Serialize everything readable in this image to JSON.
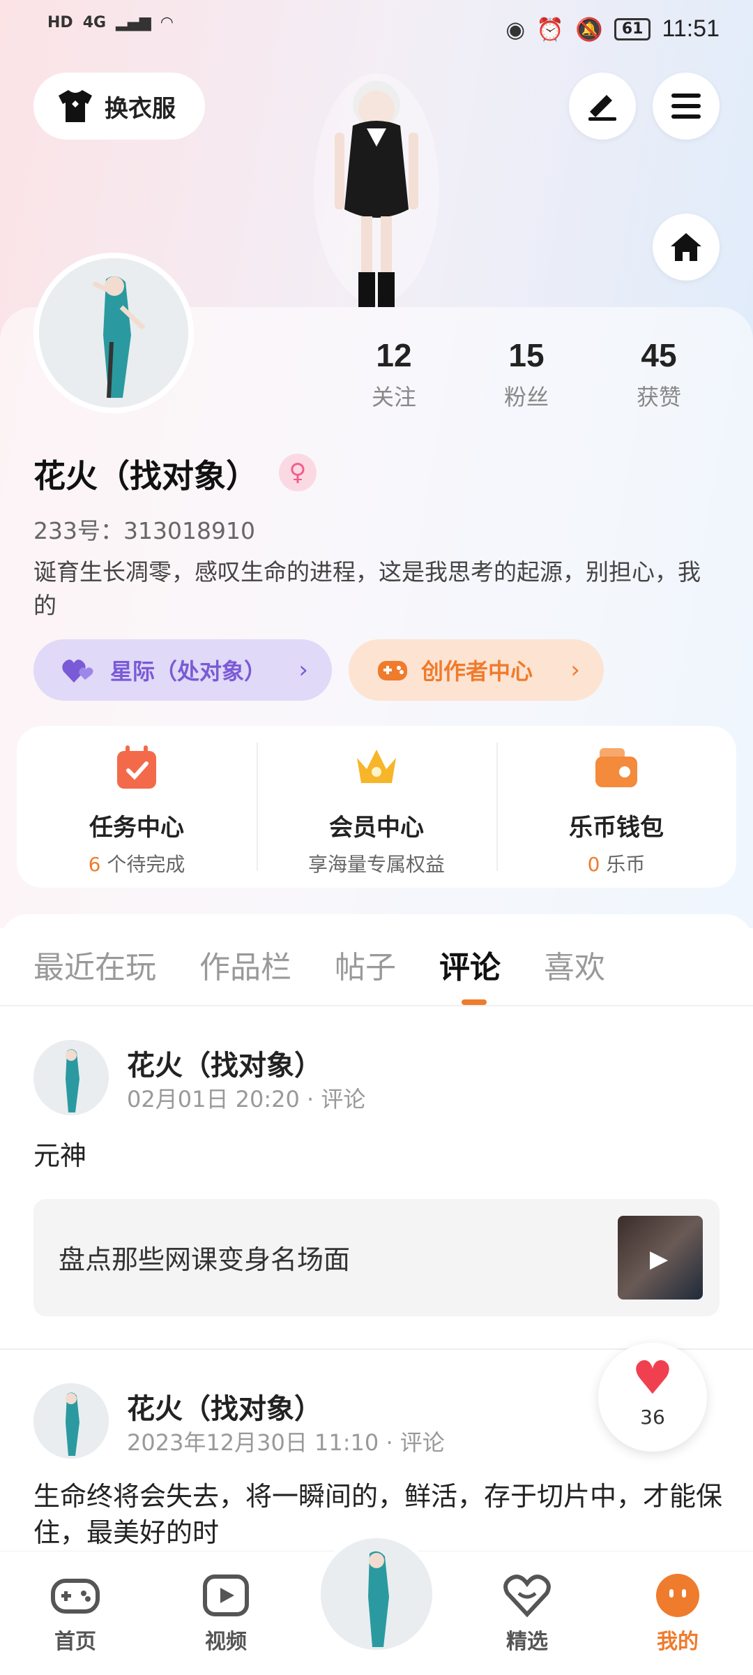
{
  "status_bar": {
    "left_indicators": [
      "HD",
      "4G"
    ],
    "battery": "61",
    "time": "11:51"
  },
  "header": {
    "outfit_label": "换衣服"
  },
  "profile": {
    "stats": [
      {
        "num": "12",
        "label": "关注"
      },
      {
        "num": "15",
        "label": "粉丝"
      },
      {
        "num": "45",
        "label": "获赞"
      }
    ],
    "name": "花火（找对象）",
    "gender_symbol": "♀",
    "uid": "233号：313018910",
    "bio": "诞育生长凋零，感叹生命的进程，这是我思考的起源，别担心，我的"
  },
  "pills": {
    "interstellar": "星际（处对象）",
    "creator": "创作者中心"
  },
  "quick": [
    {
      "title": "任务中心",
      "sub_num": "6",
      "sub_text": " 个待完成"
    },
    {
      "title": "会员中心",
      "sub_num": "",
      "sub_text": "享海量专属权益"
    },
    {
      "title": "乐币钱包",
      "sub_num": "0",
      "sub_text": " 乐币"
    }
  ],
  "tabs": [
    "最近在玩",
    "作品栏",
    "帖子",
    "评论",
    "喜欢"
  ],
  "posts": [
    {
      "name": "花火（找对象）",
      "meta": "02月01日 20:20 · 评论",
      "body": "元神",
      "ref_title": "盘点那些网课变身名场面"
    },
    {
      "name": "花火（找对象）",
      "meta": "2023年12月30日 11:10 · 评论",
      "body": "生命终将会失去，将一瞬间的，鲜活，存于切片中，才能保住，最美好的时"
    }
  ],
  "like_count": "36",
  "bottom_nav": [
    {
      "label": "首页"
    },
    {
      "label": "视频"
    },
    {
      "label": "精选"
    },
    {
      "label": "我的"
    }
  ],
  "colors": {
    "accent_orange": "#ef7b2c",
    "accent_purple": "#7a5ad6"
  }
}
